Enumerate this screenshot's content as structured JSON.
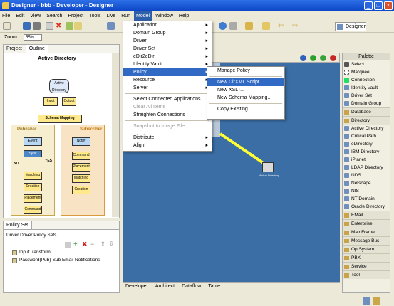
{
  "window": {
    "title": "Designer - bbb - Developer - Designer"
  },
  "menubar": [
    "File",
    "Edit",
    "View",
    "Search",
    "Project",
    "Tools",
    "Live",
    "Run",
    "Model",
    "Window",
    "Help"
  ],
  "zoom": {
    "label": "Zoom:",
    "value": "55%"
  },
  "perspective": {
    "label": "Designer"
  },
  "left_tabs": {
    "project": "Project",
    "outline": "Outline"
  },
  "outline": {
    "title": "Active Directory",
    "node_center": "Active Directory",
    "input": "Input",
    "output": "Output",
    "schema": "Schema Mapping",
    "publisher": "Publisher",
    "subscriber": "Subscriber",
    "pub_boxes": [
      "Event",
      "Sync",
      "Matching",
      "Creation",
      "Placement",
      "Command"
    ],
    "sub_boxes": [
      "Notify",
      "Command",
      "Placement",
      "Matching",
      "Creation"
    ],
    "yes": "YES",
    "no": "NO"
  },
  "policy_set": {
    "tab": "Policy Set",
    "heading": "Driver Driver Policy Sets",
    "items": [
      "InputTransform",
      "Password(Pub)-Sub Email Notifications"
    ]
  },
  "canvas": {
    "node_label": "Active Directory"
  },
  "canvas_tabs": [
    "Developer",
    "Architect",
    "Dataflow",
    "Table"
  ],
  "palette": {
    "title": "Palette",
    "tools": [
      "Select",
      "Marquee",
      "Connection"
    ],
    "items": [
      "Identity Vault",
      "Driver Set",
      "Domain Group"
    ],
    "drawers": [
      "Database",
      "Directory"
    ],
    "directory_items": [
      "Active Directory",
      "Critical Path",
      "eDirectory",
      "IBM Directory",
      "iPlanet",
      "LDAP Directory",
      "NDS",
      "Netscape",
      "NIS",
      "NT Domain",
      "Oracle Directory"
    ],
    "more_drawers": [
      "EMail",
      "Enterprise",
      "MainFrame",
      "Message Bus",
      "Op System",
      "PBX",
      "Service",
      "Tool"
    ]
  },
  "model_menu": {
    "items": [
      {
        "label": "Application",
        "submenu": true
      },
      {
        "label": "Domain Group",
        "submenu": true
      },
      {
        "label": "Driver",
        "submenu": true
      },
      {
        "label": "Driver Set",
        "submenu": true
      },
      {
        "label": "eDir2eDir",
        "submenu": true
      },
      {
        "label": "Identity Vault",
        "submenu": true
      },
      {
        "label": "Policy",
        "submenu": true,
        "selected": true
      },
      {
        "label": "Resource",
        "submenu": true
      },
      {
        "label": "Server",
        "submenu": true
      }
    ],
    "group2": [
      {
        "label": "Select Connected Applications",
        "disabled": false
      },
      {
        "label": "Clear All Items",
        "disabled": true
      },
      {
        "label": "Straighten Connections",
        "disabled": false
      }
    ],
    "group3": [
      {
        "label": "Snapshot to Image File",
        "disabled": true
      }
    ],
    "group4": [
      {
        "label": "Distribute",
        "submenu": true
      },
      {
        "label": "Align",
        "submenu": true
      }
    ]
  },
  "policy_submenu": {
    "items": [
      "Manage Policy"
    ],
    "new_items": [
      "New DirXML Script...",
      "New XSLT...",
      "New Schema Mapping..."
    ],
    "copy": "Copy Existing...",
    "selected_index": 0
  }
}
